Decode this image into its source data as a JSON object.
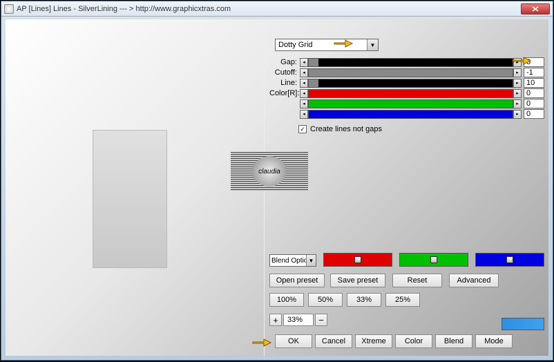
{
  "window": {
    "title": "AP [Lines]  Lines - SilverLining   --- > http://www.graphicxtras.com"
  },
  "preset": {
    "selected": "Dotty Grid"
  },
  "sliders": {
    "gap": {
      "label": "Gap:",
      "value": "6"
    },
    "cutoff": {
      "label": "Cutoff:",
      "value": "-1"
    },
    "line": {
      "label": "Line:",
      "value": "10"
    },
    "colorR": {
      "label": "Color[R]:",
      "value": "0"
    },
    "colorG": {
      "label": "",
      "value": "0"
    },
    "colorB": {
      "label": "",
      "value": "0"
    }
  },
  "checkbox": {
    "label": "Create lines not gaps",
    "checked": true
  },
  "watermark": {
    "text": "claudia"
  },
  "blend": {
    "label": "Blend Optio"
  },
  "buttons": {
    "open": "Open preset",
    "save": "Save preset",
    "reset": "Reset",
    "advanced": "Advanced",
    "p100": "100%",
    "p50": "50%",
    "p33": "33%",
    "p25": "25%",
    "ok": "OK",
    "cancel": "Cancel",
    "xtreme": "Xtreme",
    "color": "Color",
    "blendBtn": "Blend",
    "mode": "Mode"
  },
  "percent": {
    "value": "33%"
  },
  "colors": {
    "red": "#e00000",
    "green": "#00c000",
    "blue": "#0000e0",
    "swatch": "#3090e0"
  }
}
